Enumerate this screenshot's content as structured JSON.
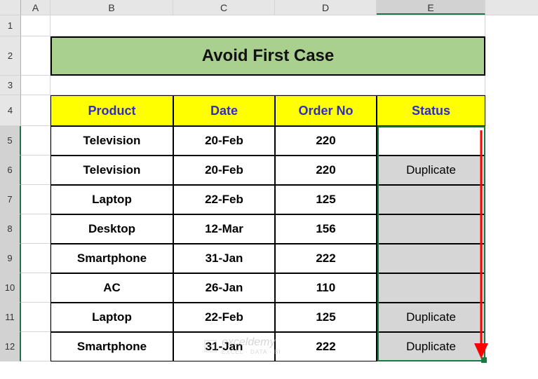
{
  "columns": {
    "A": "A",
    "B": "B",
    "C": "C",
    "D": "D",
    "E": "E"
  },
  "row_labels": [
    "1",
    "2",
    "3",
    "4",
    "5",
    "6",
    "7",
    "8",
    "9",
    "10",
    "11",
    "12"
  ],
  "title": "Avoid First Case",
  "headers": {
    "product": "Product",
    "date": "Date",
    "order_no": "Order No",
    "status": "Status"
  },
  "rows": [
    {
      "product": "Television",
      "date": "20-Feb",
      "order_no": "220",
      "status": "",
      "status_bg": "white"
    },
    {
      "product": "Television",
      "date": "20-Feb",
      "order_no": "220",
      "status": "Duplicate",
      "status_bg": "gray"
    },
    {
      "product": "Laptop",
      "date": "22-Feb",
      "order_no": "125",
      "status": "",
      "status_bg": "gray"
    },
    {
      "product": "Desktop",
      "date": "12-Mar",
      "order_no": "156",
      "status": "",
      "status_bg": "gray"
    },
    {
      "product": "Smartphone",
      "date": "31-Jan",
      "order_no": "222",
      "status": "",
      "status_bg": "gray"
    },
    {
      "product": "AC",
      "date": "26-Jan",
      "order_no": "110",
      "status": "",
      "status_bg": "gray"
    },
    {
      "product": "Laptop",
      "date": "22-Feb",
      "order_no": "125",
      "status": "Duplicate",
      "status_bg": "gray"
    },
    {
      "product": "Smartphone",
      "date": "31-Jan",
      "order_no": "222",
      "status": "Duplicate",
      "status_bg": "gray"
    }
  ],
  "watermark": "exceldemy",
  "watermark_sub": "EXCEL · DATA · BI",
  "chart_data": {
    "type": "table",
    "title": "Avoid First Case",
    "columns": [
      "Product",
      "Date",
      "Order No",
      "Status"
    ],
    "rows": [
      [
        "Television",
        "20-Feb",
        220,
        ""
      ],
      [
        "Television",
        "20-Feb",
        220,
        "Duplicate"
      ],
      [
        "Laptop",
        "22-Feb",
        125,
        ""
      ],
      [
        "Desktop",
        "12-Mar",
        156,
        ""
      ],
      [
        "Smartphone",
        "31-Jan",
        222,
        ""
      ],
      [
        "AC",
        "26-Jan",
        110,
        ""
      ],
      [
        "Laptop",
        "22-Feb",
        125,
        "Duplicate"
      ],
      [
        "Smartphone",
        "31-Jan",
        222,
        "Duplicate"
      ]
    ]
  }
}
